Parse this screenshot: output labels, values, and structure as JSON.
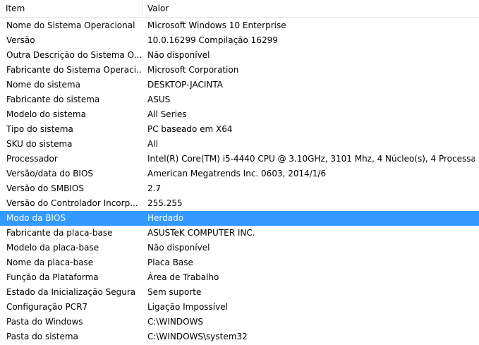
{
  "columns": {
    "item": "Item",
    "value": "Valor"
  },
  "selected_row_color": "#3399ff",
  "rows": [
    {
      "item": "Nome do Sistema Operacional",
      "value": "Microsoft Windows 10 Enterprise"
    },
    {
      "item": "Versão",
      "value": "10.0.16299 Compilação 16299"
    },
    {
      "item": "Outra Descrição do Sistema O...",
      "value": "Não disponível"
    },
    {
      "item": "Fabricante do Sistema Operaci...",
      "value": "Microsoft Corporation"
    },
    {
      "item": "Nome do sistema",
      "value": "DESKTOP-JACINTA"
    },
    {
      "item": "Fabricante do sistema",
      "value": "ASUS"
    },
    {
      "item": "Modelo do sistema",
      "value": "All Series"
    },
    {
      "item": "Tipo do sistema",
      "value": "PC baseado em X64"
    },
    {
      "item": "SKU do sistema",
      "value": "All"
    },
    {
      "item": "Processador",
      "value": "Intel(R) Core(TM) i5-4440 CPU @ 3.10GHz, 3101 Mhz, 4 Núcleo(s), 4 Processa..."
    },
    {
      "item": "Versão/data do BIOS",
      "value": "American Megatrends Inc. 0603, 2014/1/6"
    },
    {
      "item": "Versão do SMBIOS",
      "value": "2.7"
    },
    {
      "item": "Versão do Controlador Incorp...",
      "value": "255.255"
    },
    {
      "item": "Modo da BIOS",
      "value": "Herdado",
      "selected": true
    },
    {
      "item": "Fabricante da placa-base",
      "value": "ASUSTeK COMPUTER INC."
    },
    {
      "item": "Modelo da placa-base",
      "value": "Não disponível"
    },
    {
      "item": "Nome da placa-base",
      "value": "Placa Base"
    },
    {
      "item": "Função da Plataforma",
      "value": "Área de Trabalho"
    },
    {
      "item": "Estado da Inicialização Segura",
      "value": "Sem suporte"
    },
    {
      "item": "Configuração PCR7",
      "value": "Ligação Impossível"
    },
    {
      "item": "Pasta do Windows",
      "value": "C:\\WINDOWS"
    },
    {
      "item": "Pasta do sistema",
      "value": "C:\\WINDOWS\\system32"
    }
  ]
}
